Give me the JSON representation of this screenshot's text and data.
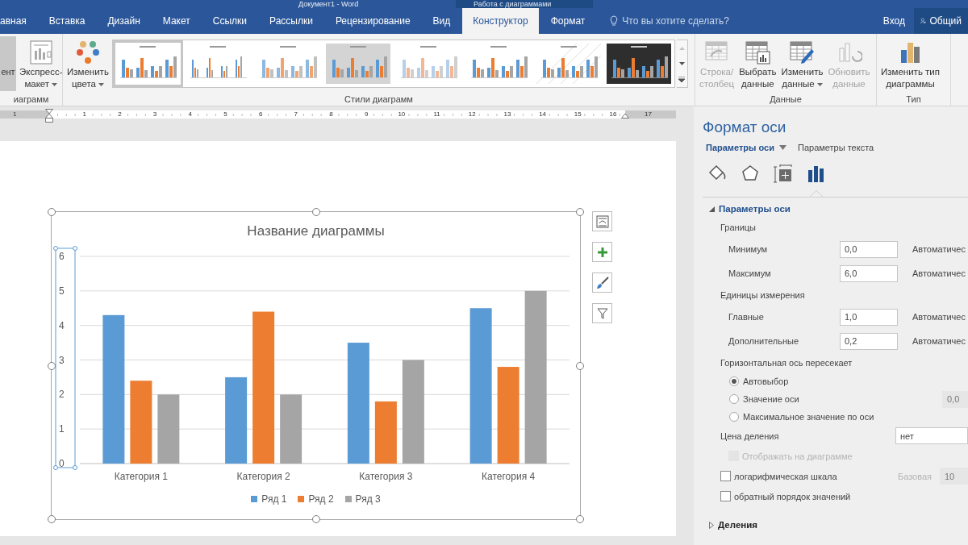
{
  "title_bar": {
    "title": "Документ1 - Word",
    "context": "Работа с диаграммами"
  },
  "tabs": [
    {
      "label": "авная",
      "selected": false
    },
    {
      "label": "Вставка",
      "selected": false
    },
    {
      "label": "Дизайн",
      "selected": false
    },
    {
      "label": "Макет",
      "selected": false
    },
    {
      "label": "Ссылки",
      "selected": false
    },
    {
      "label": "Рассылки",
      "selected": false
    },
    {
      "label": "Рецензирование",
      "selected": false
    },
    {
      "label": "Вид",
      "selected": false
    },
    {
      "label": "Конструктор",
      "selected": true
    },
    {
      "label": "Формат",
      "selected": false
    }
  ],
  "tell_me": {
    "placeholder": "Что вы хотите сделать?"
  },
  "account": {
    "sign_in": "Вход",
    "share": "Общий"
  },
  "ribbon": {
    "groups": [
      {
        "label": "иаграмм",
        "buttons": [
          {
            "kind": "partial",
            "lines": [
              "ент"
            ],
            "dropdown": false,
            "disabled": false
          },
          {
            "kind": "quick-layout",
            "lines": [
              "Экспресс-",
              "макет"
            ],
            "dropdown": true,
            "disabled": false
          }
        ]
      },
      {
        "label": "Стили диаграмм",
        "buttons": [
          {
            "kind": "colors",
            "lines": [
              "Изменить",
              "цвета"
            ],
            "dropdown": true,
            "disabled": false
          }
        ],
        "gallery": {
          "styles": [
            {
              "kind": "plain",
              "selected": true
            },
            {
              "kind": "thin",
              "selected": false
            },
            {
              "kind": "striped",
              "selected": false
            },
            {
              "kind": "shaded",
              "selected": false
            },
            {
              "kind": "light",
              "selected": false
            },
            {
              "kind": "plain",
              "selected": false
            },
            {
              "kind": "hatched",
              "selected": false
            },
            {
              "kind": "dark",
              "selected": false
            }
          ]
        }
      },
      {
        "label": "Данные",
        "buttons": [
          {
            "kind": "switch",
            "lines": [
              "Строка/",
              "столбец"
            ],
            "dropdown": false,
            "disabled": true
          },
          {
            "kind": "select-data",
            "lines": [
              "Выбрать",
              "данные"
            ],
            "dropdown": false,
            "disabled": false
          },
          {
            "kind": "edit-data",
            "lines": [
              "Изменить",
              "данные"
            ],
            "dropdown": true,
            "disabled": false
          },
          {
            "kind": "refresh",
            "lines": [
              "Обновить",
              "данные"
            ],
            "dropdown": false,
            "disabled": true
          }
        ]
      },
      {
        "label": "Тип",
        "buttons": [
          {
            "kind": "chart-type",
            "lines": [
              "Изменить тип",
              "диаграммы"
            ],
            "dropdown": false,
            "disabled": false
          }
        ]
      }
    ]
  },
  "ruler": {
    "left_numbers": [
      "1"
    ],
    "numbers": [
      "1",
      "2",
      "3",
      "4",
      "5",
      "6",
      "7",
      "8",
      "9",
      "10",
      "11",
      "12",
      "13",
      "14",
      "15",
      "16"
    ],
    "right_numbers": [
      "17"
    ]
  },
  "chart": {
    "value_axis": {
      "selected": true
    },
    "chart_data": {
      "type": "bar",
      "title": "Название диаграммы",
      "categories": [
        "Категория 1",
        "Категория 2",
        "Категория 3",
        "Категория 4"
      ],
      "series": [
        {
          "name": "Ряд 1",
          "color": "#5b9bd5",
          "values": [
            4.3,
            2.5,
            3.5,
            4.5
          ]
        },
        {
          "name": "Ряд 2",
          "color": "#ed7d31",
          "values": [
            2.4,
            4.4,
            1.8,
            2.8
          ]
        },
        {
          "name": "Ряд 3",
          "color": "#a5a5a5",
          "values": [
            2,
            2,
            3,
            5
          ]
        }
      ],
      "ylim": [
        0,
        6
      ],
      "yticks": [
        0,
        1,
        2,
        3,
        4,
        5,
        6
      ],
      "grid": true
    }
  },
  "pane": {
    "title": "Формат оси",
    "tabs": [
      {
        "label": "Параметры оси",
        "selected": true,
        "dropdown": true
      },
      {
        "label": "Параметры текста",
        "selected": false,
        "dropdown": false
      }
    ],
    "icon_tabs": [
      {
        "kind": "fill",
        "selected": false
      },
      {
        "kind": "effects",
        "selected": false
      },
      {
        "kind": "size",
        "selected": false
      },
      {
        "kind": "axis",
        "selected": true
      }
    ],
    "sections": [
      {
        "title": "Параметры оси",
        "expanded": true,
        "items": [
          {
            "kind": "group",
            "label": "Границы",
            "children": [
              {
                "kind": "field",
                "label": "Минимум",
                "value": "0,0",
                "auto": "Автоматичес"
              },
              {
                "kind": "field",
                "label": "Максимум",
                "value": "6,0",
                "auto": "Автоматичес"
              }
            ]
          },
          {
            "kind": "group",
            "label": "Единицы измерения",
            "children": [
              {
                "kind": "field",
                "label": "Главные",
                "value": "1,0",
                "auto": "Автоматичес"
              },
              {
                "kind": "field",
                "label": "Дополнительные",
                "value": "0,2",
                "auto": "Автоматичес"
              }
            ]
          },
          {
            "kind": "group",
            "label": "Горизонтальная ось пересекает",
            "children": [
              {
                "kind": "radio",
                "label": "Автовыбор",
                "selected": true
              },
              {
                "kind": "radio",
                "label": "Значение оси",
                "selected": false,
                "value": "0,0"
              },
              {
                "kind": "radio",
                "label": "Максимальное значение по оси",
                "selected": false
              }
            ]
          },
          {
            "kind": "select",
            "label": "Цена деления",
            "value": "нет",
            "children": [
              {
                "kind": "checkbox",
                "label": "Отображать на диаграмме",
                "checked": false,
                "disabled": true
              }
            ]
          },
          {
            "kind": "checkbox",
            "label": "логарифмическая шкала",
            "checked": false,
            "disabled": false,
            "base_label": "Базовая",
            "base_value": "10"
          },
          {
            "kind": "checkbox",
            "label": "обратный порядок значений",
            "checked": false,
            "disabled": false
          }
        ]
      },
      {
        "title": "Деления",
        "expanded": false
      }
    ]
  }
}
